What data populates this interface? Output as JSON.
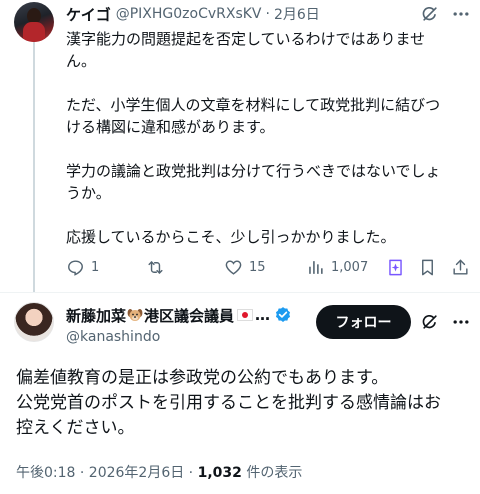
{
  "reply": {
    "name": "ケイゴ",
    "handle": "@PIXHG0zoCvRXsKV",
    "separator": "·",
    "date": "2月6日",
    "paragraphs": [
      "漢字能力の問題提起を否定しているわけではありませ",
      "ん。",
      "",
      "ただ、小学生個人の文章を材料にして政党批判に結びつ",
      "ける構図に違和感があります。",
      "",
      "学力の議論と政党批判は分けて行うべきではないでしょ",
      "うか。",
      "",
      "応援しているからこそ、少し引っかかりました。"
    ],
    "actions": {
      "replies": "1",
      "retweets": "",
      "likes": "15",
      "views": "1,007"
    }
  },
  "main": {
    "name": "新藤加菜",
    "name_suffix": "港区議会議員",
    "ellipsis": "…",
    "handle": "@kanashindo",
    "follow_label": "フォロー",
    "lines": [
      "偏差値教育の是正は参政党の公約でもあります。",
      "公党党首のポストを引用することを批判する感情論はお",
      "控えください。"
    ],
    "time": "午後0:18 · 2026年2月6日 · ",
    "view_count": "1,032",
    "view_suffix": " 件の表示"
  },
  "colors": {
    "text": "#0f1419",
    "muted": "#536471",
    "verified": "#1d9bf0",
    "follow_bg": "#0f1419"
  },
  "icons": [
    "grok-icon",
    "more-icon",
    "reply-icon",
    "retweet-icon",
    "like-icon",
    "views-icon",
    "bookmark-icon",
    "share-icon",
    "verified-icon",
    "dog-emoji",
    "japan-flag"
  ]
}
